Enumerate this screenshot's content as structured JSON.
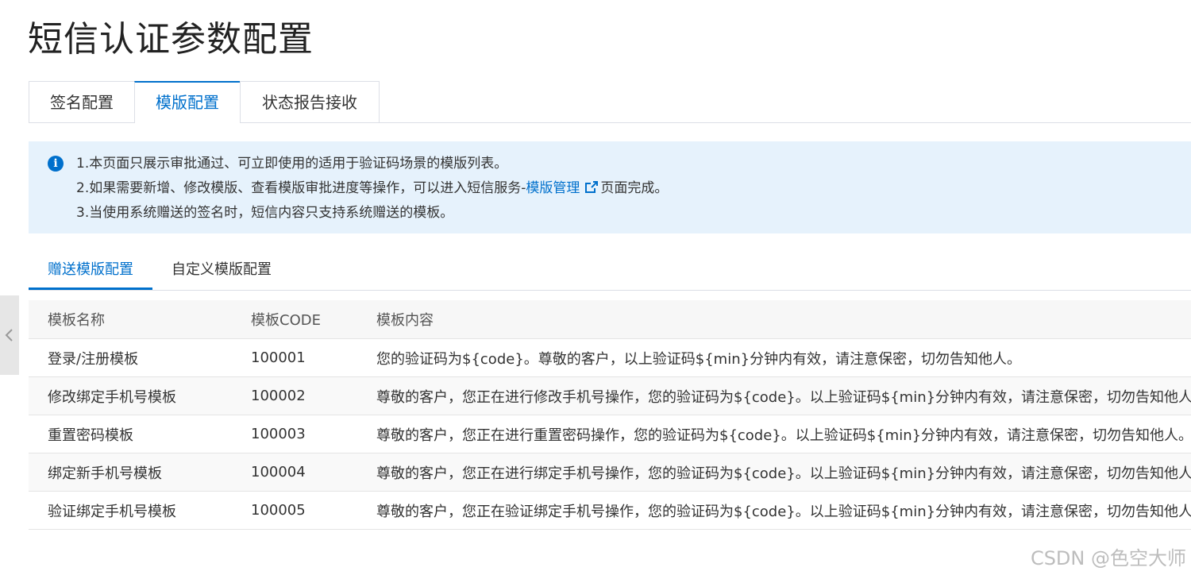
{
  "page": {
    "title": "短信认证参数配置"
  },
  "top_tabs": [
    {
      "label": "签名配置"
    },
    {
      "label": "模版配置"
    },
    {
      "label": "状态报告接收"
    }
  ],
  "notice": {
    "icon": "info-icon",
    "line1": "1.本页面只展示审批通过、可立即使用的适用于验证码场景的模版列表。",
    "line2_prefix": "2.如果需要新增、修改模版、查看模版审批进度等操作，可以进入短信服务-",
    "line2_link": "模版管理",
    "line2_suffix": "页面完成。",
    "line3": "3.当使用系统赠送的签名时，短信内容只支持系统赠送的模板。"
  },
  "sub_tabs": [
    {
      "label": "赠送模版配置"
    },
    {
      "label": "自定义模版配置"
    }
  ],
  "table": {
    "headers": [
      "模板名称",
      "模板CODE",
      "模板内容"
    ],
    "rows": [
      [
        "登录/注册模板",
        "100001",
        "您的验证码为${code}。尊敬的客户，以上验证码${min}分钟内有效，请注意保密，切勿告知他人。"
      ],
      [
        "修改绑定手机号模板",
        "100002",
        "尊敬的客户，您正在进行修改手机号操作，您的验证码为${code}。以上验证码${min}分钟内有效，请注意保密，切勿告知他人。"
      ],
      [
        "重置密码模板",
        "100003",
        "尊敬的客户，您正在进行重置密码操作，您的验证码为${code}。以上验证码${min}分钟内有效，请注意保密，切勿告知他人。"
      ],
      [
        "绑定新手机号模板",
        "100004",
        "尊敬的客户，您正在进行绑定手机号操作，您的验证码为${code}。以上验证码${min}分钟内有效，请注意保密，切勿告知他人。"
      ],
      [
        "验证绑定手机号模板",
        "100005",
        "尊敬的客户，您正在验证绑定手机号操作，您的验证码为${code}。以上验证码${min}分钟内有效，请注意保密，切勿告知他人。"
      ]
    ]
  },
  "watermark": "CSDN @色空大师",
  "colors": {
    "accent": "#0070cc",
    "notice_bg": "#e6f2fc"
  }
}
